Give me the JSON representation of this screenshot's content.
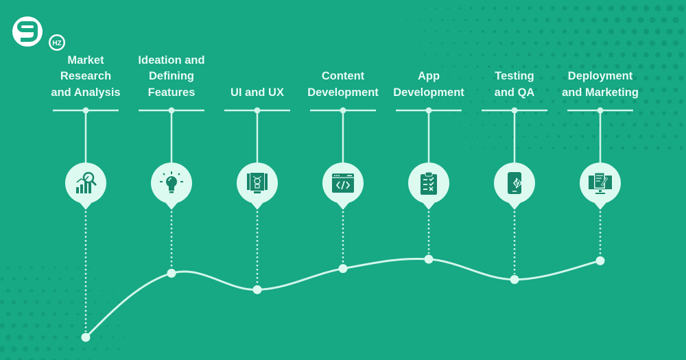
{
  "brand": {
    "logo_text": "HZ",
    "logo_mark": "9"
  },
  "colors": {
    "background": "#17a884",
    "line": "#d2f6ea",
    "pin": "#dcfaf0",
    "icon": "#17866a",
    "text": "#e8fbf5"
  },
  "steps": [
    {
      "label_lines": [
        "Market",
        "Research",
        "and Analysis"
      ],
      "icon": "market-research-icon",
      "curve_level": 0
    },
    {
      "label_lines": [
        "Ideation and",
        "Defining",
        "Features"
      ],
      "icon": "lightbulb-icon",
      "curve_level": 0.82
    },
    {
      "label_lines": [
        "UI and UX"
      ],
      "icon": "ui-ux-design-icon",
      "curve_level": 0.61
    },
    {
      "label_lines": [
        "Content",
        "Development"
      ],
      "icon": "code-window-icon",
      "curve_level": 0.88
    },
    {
      "label_lines": [
        "App",
        "Development"
      ],
      "icon": "clipboard-checklist-icon",
      "curve_level": 1.0
    },
    {
      "label_lines": [
        "Testing",
        "and QA"
      ],
      "icon": "mobile-code-icon",
      "curve_level": 0.74
    },
    {
      "label_lines": [
        "Deployment",
        "and Marketing"
      ],
      "icon": "monitor-edit-icon",
      "curve_level": 0.98
    }
  ]
}
